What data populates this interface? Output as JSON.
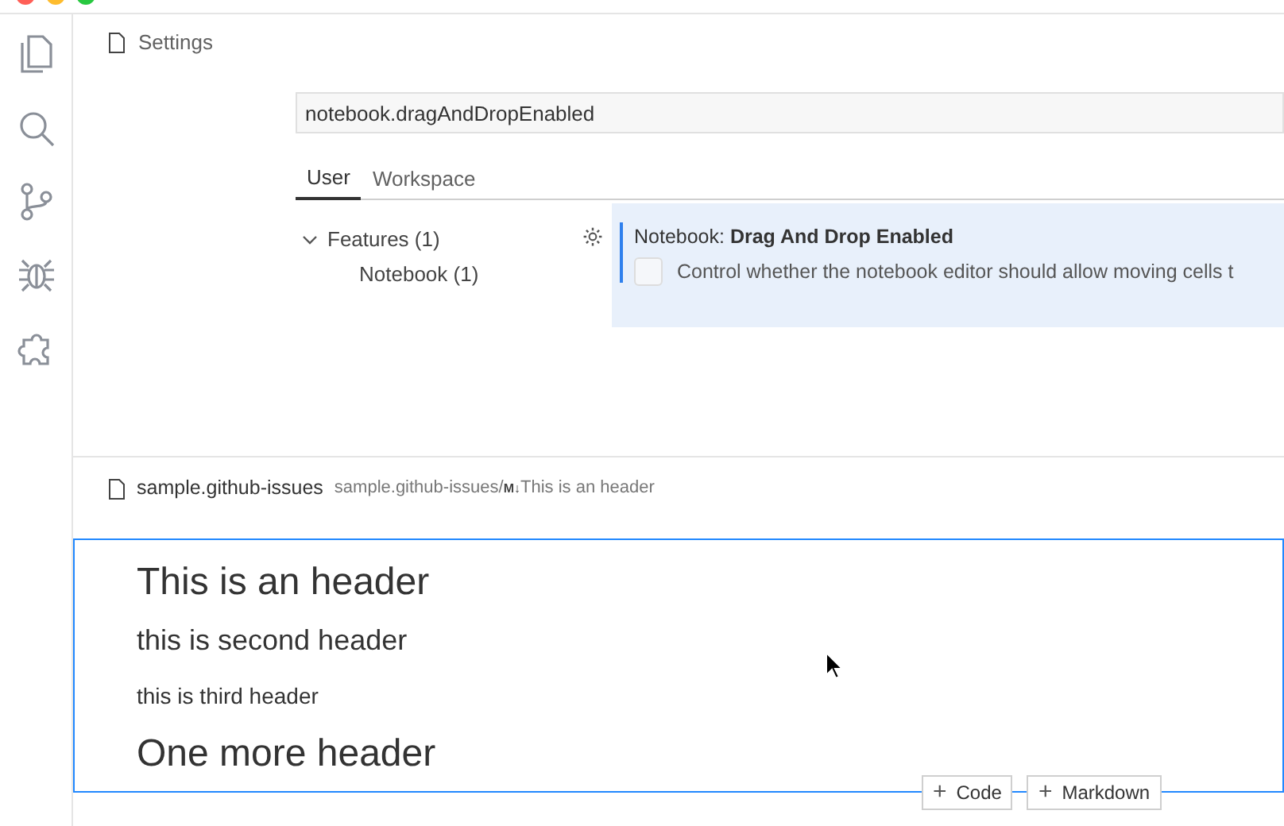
{
  "activity_bar": [
    {
      "kind": "files"
    },
    {
      "kind": "search"
    },
    {
      "kind": "source-control"
    },
    {
      "kind": "debug"
    },
    {
      "kind": "extensions"
    }
  ],
  "settings": {
    "title": "Settings",
    "search": {
      "value": "notebook.dragAndDropEnabled"
    },
    "tabs": [
      {
        "label": "User",
        "selected": true
      },
      {
        "label": "Workspace",
        "selected": false
      }
    ],
    "tree": [
      {
        "label": "Features (1)",
        "expanded": true,
        "children": [
          {
            "label": "Notebook (1)"
          }
        ]
      }
    ],
    "setting": {
      "category": "Notebook: ",
      "name": "Drag And Drop Enabled",
      "checked": false,
      "description": "Control whether the notebook editor should allow moving cells t"
    }
  },
  "notebook": {
    "title": "sample.github-issues",
    "breadcrumb_path": "sample.github-issues/",
    "breadcrumb_badge": "M↓",
    "breadcrumb_item": "This is an header",
    "cell": {
      "headings": [
        {
          "kind": "h1",
          "text": "This is an header"
        },
        {
          "kind": "h2",
          "text": "this is second header"
        },
        {
          "kind": "h3",
          "text": "this is third header"
        },
        {
          "kind": "h1",
          "text": "One more header"
        }
      ]
    },
    "add_buttons": [
      {
        "icon": "+",
        "label": "Code"
      },
      {
        "icon": "+",
        "label": "Markdown"
      }
    ]
  }
}
